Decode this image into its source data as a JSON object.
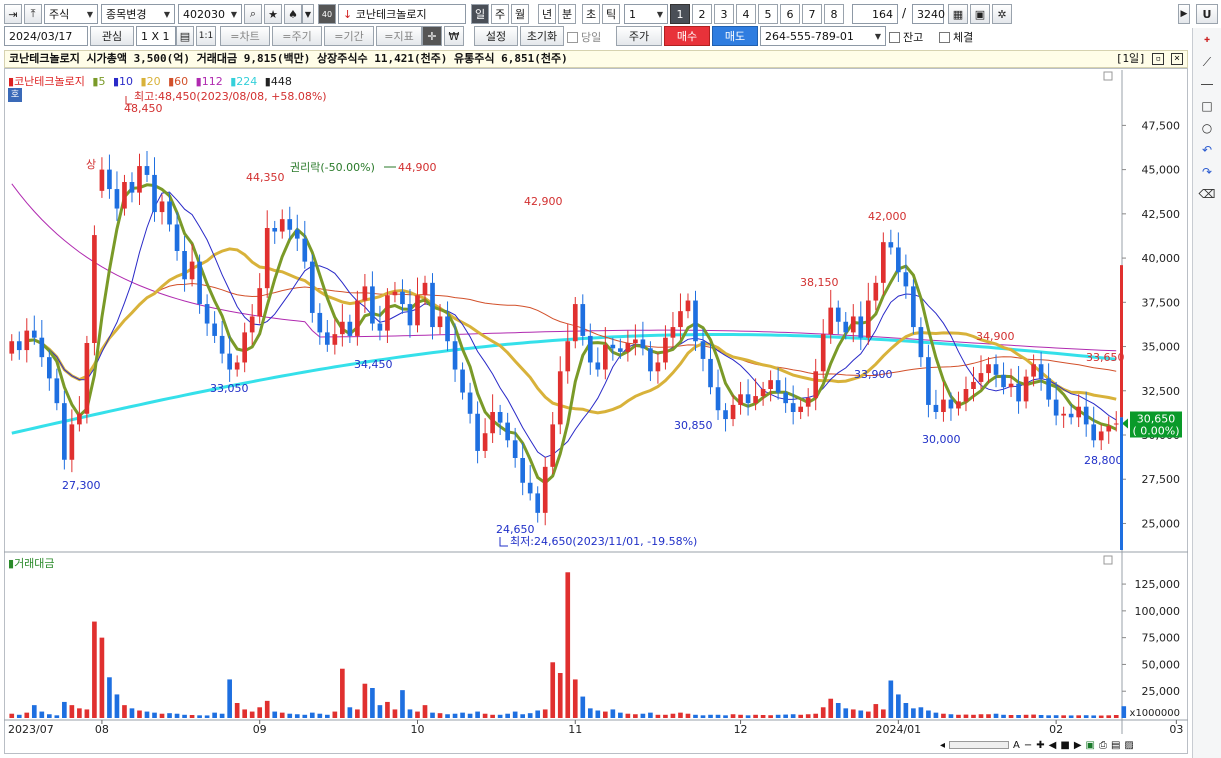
{
  "toolbar": {
    "market_type": "주식",
    "stock_change": "종목변경",
    "code": "402030",
    "name": "코난테크놀로지",
    "periods": [
      "일",
      "주",
      "월",
      "년",
      "분",
      "초",
      "틱"
    ],
    "active_period": "일",
    "interval_value": "1",
    "chart_count_buttons": [
      "1",
      "2",
      "3",
      "4",
      "5",
      "6",
      "7",
      "8"
    ],
    "active_chart_count": "1",
    "shown_count": "164",
    "total_count": "3240",
    "u_label": "U"
  },
  "toolbar2": {
    "date": "2024/03/17",
    "interest": "관심",
    "layout": "1 X 1",
    "one_one": "1:1",
    "chart_btn": "=차트",
    "cycle_btn": "=주기",
    "period_btn": "=기간",
    "indicator_btn": "=지표",
    "won_btn": "₩",
    "setting": "설정",
    "reset": "초기화",
    "same_day": "당일",
    "price_btn": "주가",
    "buy": "매수",
    "sell": "매도",
    "account": "264-555-789-01",
    "balance": "잔고",
    "contract": "체결"
  },
  "info_bar": {
    "text": "코난테크놀로지  시가총액 3,500(억)  거래대금 9,815(백만)  상장주식수 11,421(천주)  유통주식 6,851(천주)",
    "period_tag": "[1일]"
  },
  "legend": {
    "name": "코난테크놀로지",
    "mas": [
      {
        "label": "5",
        "color": "#7b3fb0"
      },
      {
        "label": "10",
        "color": "#2f3fd6"
      },
      {
        "label": "20",
        "color": "#e0b030"
      },
      {
        "label": "60",
        "color": "#d04a1a"
      },
      {
        "label": "112",
        "color": "#b33fb3"
      },
      {
        "label": "224",
        "color": "#33dde6"
      },
      {
        "label": "448",
        "color": "#222222"
      }
    ],
    "ho": "호"
  },
  "volume_legend": "거래대금",
  "colors": {
    "up": "#e0302f",
    "down": "#1e6fe0",
    "ma5": "#7a9a28",
    "ma10": "#2a2ac8",
    "ma20": "#d8b23a",
    "ma60": "#d2502a",
    "ma112": "#b02ab0",
    "ma224": "#35e0ea"
  },
  "chart_data": {
    "type": "candlestick",
    "price_axis": {
      "ticks": [
        "47,500",
        "45,000",
        "42,500",
        "40,000",
        "37,500",
        "35,000",
        "32,500",
        "30,000",
        "27,500",
        "25,000"
      ],
      "ylim": [
        23500,
        49500
      ]
    },
    "volume_axis": {
      "ticks": [
        "125,000",
        "100,000",
        "75,000",
        "50,000",
        "25,000"
      ],
      "unit": "x1000000",
      "ylim": [
        0,
        140000
      ]
    },
    "x_labels": [
      "2023/07",
      "08",
      "09",
      "10",
      "11",
      "12",
      "2024/01",
      "02",
      "03",
      "03"
    ],
    "annotations": [
      {
        "text": "최고:48,450(2023/08/08, +58.08%)",
        "color": "#d23030"
      },
      {
        "text": "48,450",
        "color": "#d23030"
      },
      {
        "text": "상",
        "color": "#d23030"
      },
      {
        "text": "44,350",
        "color": "#d23030"
      },
      {
        "text": "권리락(-50.00%)",
        "color": "#2a7a2a"
      },
      {
        "text": "44,900",
        "color": "#d23030"
      },
      {
        "text": "42,900",
        "color": "#d23030"
      },
      {
        "text": "42,000",
        "color": "#d23030"
      },
      {
        "text": "38,150",
        "color": "#d23030"
      },
      {
        "text": "34,900",
        "color": "#d23030"
      },
      {
        "text": "33,650",
        "color": "#d23030"
      },
      {
        "text": "27,300",
        "color": "#2030c8"
      },
      {
        "text": "33,050",
        "color": "#2030c8"
      },
      {
        "text": "34,450",
        "color": "#2030c8"
      },
      {
        "text": "24,650",
        "color": "#2030c8"
      },
      {
        "text": "최저:24,650(2023/11/01, -19.58%)",
        "color": "#2030c8"
      },
      {
        "text": "30,850",
        "color": "#2030c8"
      },
      {
        "text": "33,900",
        "color": "#2030c8"
      },
      {
        "text": "30,000",
        "color": "#2030c8"
      },
      {
        "text": "28,800",
        "color": "#2030c8"
      }
    ],
    "current_price": "30,650",
    "current_change": "( 0.00%)",
    "closes": [
      35300,
      34800,
      35900,
      35500,
      34400,
      33200,
      31800,
      28600,
      30600,
      31200,
      35200,
      41300,
      45000,
      43900,
      42800,
      44300,
      43700,
      45200,
      44700,
      42600,
      43200,
      41900,
      40400,
      38800,
      39800,
      37400,
      36300,
      35600,
      34600,
      33700,
      34100,
      35800,
      36700,
      38300,
      41700,
      41500,
      42200,
      41600,
      41100,
      39800,
      36900,
      35800,
      35100,
      35700,
      36400,
      35600,
      37600,
      38400,
      36300,
      35900,
      37900,
      38100,
      37400,
      36200,
      37900,
      38600,
      36100,
      36700,
      35300,
      33700,
      32400,
      31200,
      29100,
      30100,
      31300,
      30700,
      29700,
      28700,
      27300,
      26700,
      25600,
      28200,
      30600,
      33600,
      35300,
      37400,
      35600,
      34100,
      33700,
      35100,
      34900,
      34700,
      35200,
      35400,
      34900,
      33600,
      34100,
      35500,
      36100,
      37000,
      37600,
      35300,
      34300,
      32700,
      31400,
      30900,
      31700,
      32300,
      31800,
      32200,
      32600,
      33100,
      32400,
      31800,
      31300,
      31600,
      32100,
      33600,
      35700,
      37200,
      36400,
      35800,
      36700,
      35500,
      37600,
      38600,
      40900,
      40600,
      39200,
      38400,
      36100,
      34400,
      31700,
      31300,
      32000,
      31500,
      31900,
      32600,
      33000,
      33500,
      34000,
      33400,
      32700,
      32900,
      31900,
      33300,
      34000,
      33200,
      32000,
      31100,
      31200,
      31000,
      31600,
      30600,
      29700,
      30200,
      30500,
      30650
    ],
    "opens": [
      34600,
      35300,
      34800,
      35900,
      35500,
      34400,
      33200,
      31800,
      28600,
      30600,
      31200,
      35200,
      43800,
      45000,
      43900,
      42800,
      44300,
      43700,
      45200,
      44700,
      42600,
      43200,
      41900,
      40400,
      38800,
      39800,
      37400,
      36300,
      35600,
      34600,
      33700,
      34100,
      35800,
      36700,
      38300,
      41700,
      41500,
      42200,
      41600,
      41100,
      39800,
      36900,
      35800,
      35100,
      35700,
      36400,
      35600,
      37600,
      38400,
      36300,
      35900,
      37900,
      38100,
      37400,
      36200,
      37900,
      38600,
      36100,
      36700,
      35300,
      33700,
      32400,
      31200,
      29100,
      30100,
      31300,
      30700,
      29700,
      28700,
      27300,
      26700,
      25600,
      28200,
      30600,
      33600,
      35300,
      37400,
      35600,
      34100,
      33700,
      35100,
      34900,
      34700,
      35200,
      35400,
      34900,
      33600,
      34100,
      35500,
      36100,
      37000,
      37600,
      35300,
      34300,
      32700,
      31400,
      30900,
      31700,
      32300,
      31800,
      32200,
      32600,
      33100,
      32400,
      31800,
      31300,
      31600,
      32100,
      33600,
      35700,
      37200,
      36400,
      35800,
      36700,
      35500,
      37600,
      38600,
      40900,
      40600,
      39200,
      38400,
      36100,
      34400,
      31700,
      31300,
      32000,
      31500,
      31900,
      32600,
      33000,
      33500,
      34000,
      33400,
      32700,
      32900,
      31900,
      33300,
      34000,
      33200,
      32000,
      31100,
      31200,
      31000,
      31600,
      30600,
      29700,
      30200,
      30600
    ],
    "volumes": [
      4000,
      3000,
      5000,
      12000,
      6000,
      3500,
      2500,
      15000,
      12000,
      9000,
      8000,
      90000,
      75000,
      38000,
      22000,
      12000,
      9000,
      7000,
      6000,
      5000,
      4000,
      4500,
      4000,
      3000,
      2800,
      2500,
      2400,
      5000,
      4000,
      36000,
      14000,
      8000,
      6000,
      10000,
      16000,
      6000,
      5000,
      4000,
      3500,
      3000,
      5000,
      4000,
      3000,
      6000,
      46000,
      10000,
      8000,
      32000,
      28000,
      12000,
      15000,
      8000,
      26000,
      8000,
      6000,
      12000,
      5000,
      4500,
      3500,
      4000,
      5000,
      4000,
      6000,
      4000,
      3000,
      3000,
      4000,
      6000,
      3500,
      4500,
      7000,
      8000,
      52000,
      42000,
      136000,
      36000,
      20000,
      9000,
      7000,
      6000,
      8000,
      5000,
      4000,
      3500,
      4000,
      5000,
      3000,
      3000,
      4000,
      5000,
      4000,
      3000,
      2500,
      3000,
      3000,
      2500,
      3500,
      3000,
      2500,
      3000,
      2800,
      2600,
      3000,
      3200,
      3500,
      3000,
      3500,
      4000,
      10000,
      18000,
      14000,
      9000,
      8000,
      7000,
      6000,
      13000,
      8000,
      35000,
      22000,
      14000,
      9000,
      10000,
      7000,
      5000,
      4000,
      3500,
      3000,
      3200,
      3000,
      3500,
      3500,
      4000,
      3000,
      2800,
      2800,
      3000,
      3200,
      2800,
      2500,
      2600,
      2500,
      2400,
      2500,
      2600,
      2400,
      2300,
      2500,
      2800,
      11000
    ]
  }
}
